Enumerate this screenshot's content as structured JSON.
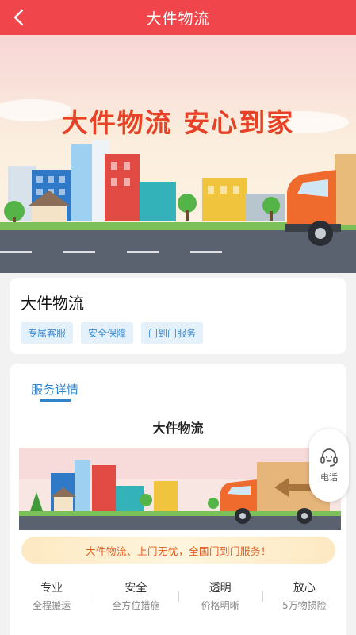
{
  "header": {
    "title": "大件物流"
  },
  "banner": {
    "slogan": "大件物流  安心到家"
  },
  "product": {
    "title": "大件物流",
    "tags": [
      "专属客服",
      "安全保障",
      "门到门服务"
    ]
  },
  "details": {
    "tab_label": "服务详情",
    "heading": "大件物流",
    "slogan": "大件物流、上门无忧，全国门到门服务！",
    "features": [
      {
        "title": "专业",
        "sub": "全程搬运"
      },
      {
        "title": "安全",
        "sub": "全方位措施"
      },
      {
        "title": "透明",
        "sub": "价格明晰"
      },
      {
        "title": "放心",
        "sub": "5万物损险"
      }
    ]
  },
  "phone": {
    "label": "电话"
  },
  "colors": {
    "accent": "#f0454a",
    "link": "#2f83c8",
    "slogan": "#e8412a"
  },
  "icons": {
    "back": "chevron-left-icon",
    "phone": "headset-icon"
  }
}
